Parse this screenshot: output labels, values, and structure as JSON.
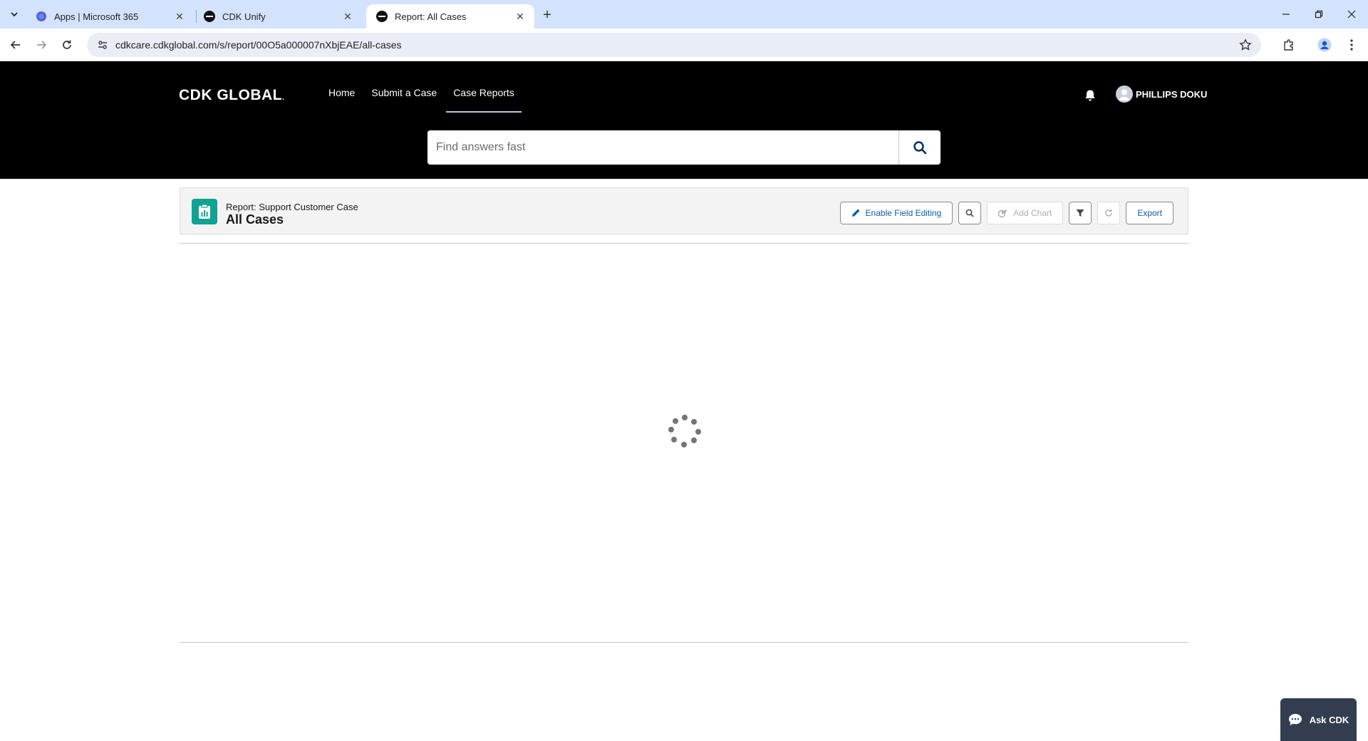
{
  "browser": {
    "tabs": [
      {
        "title": "Apps | Microsoft 365",
        "favicon": "m365-icon",
        "active": false
      },
      {
        "title": "CDK Unify",
        "favicon": "cdk-icon",
        "active": false
      },
      {
        "title": "Report: All Cases",
        "favicon": "cdk-icon",
        "active": true
      }
    ],
    "url": "cdkcare.cdkglobal.com/s/report/00O5a000007nXbjEAE/all-cases"
  },
  "site": {
    "logo": "CDK GLOBAL",
    "nav": [
      "Home",
      "Submit a Case",
      "Case Reports"
    ],
    "active_nav": "Case Reports",
    "user_name": "PHILLIPS DOKU",
    "search_placeholder": "Find answers fast"
  },
  "report": {
    "subtitle": "Report: Support Customer Case",
    "title": "All Cases",
    "actions": {
      "enable_field_editing": "Enable Field Editing",
      "add_chart": "Add Chart",
      "export": "Export"
    }
  },
  "chat": {
    "label": "Ask CDK"
  },
  "colors": {
    "header_bg": "#000000",
    "report_icon": "#0fa395",
    "link_blue": "#0b5cab",
    "chat_bg": "#323e50",
    "tabbar_bg": "#d3e3fd"
  }
}
